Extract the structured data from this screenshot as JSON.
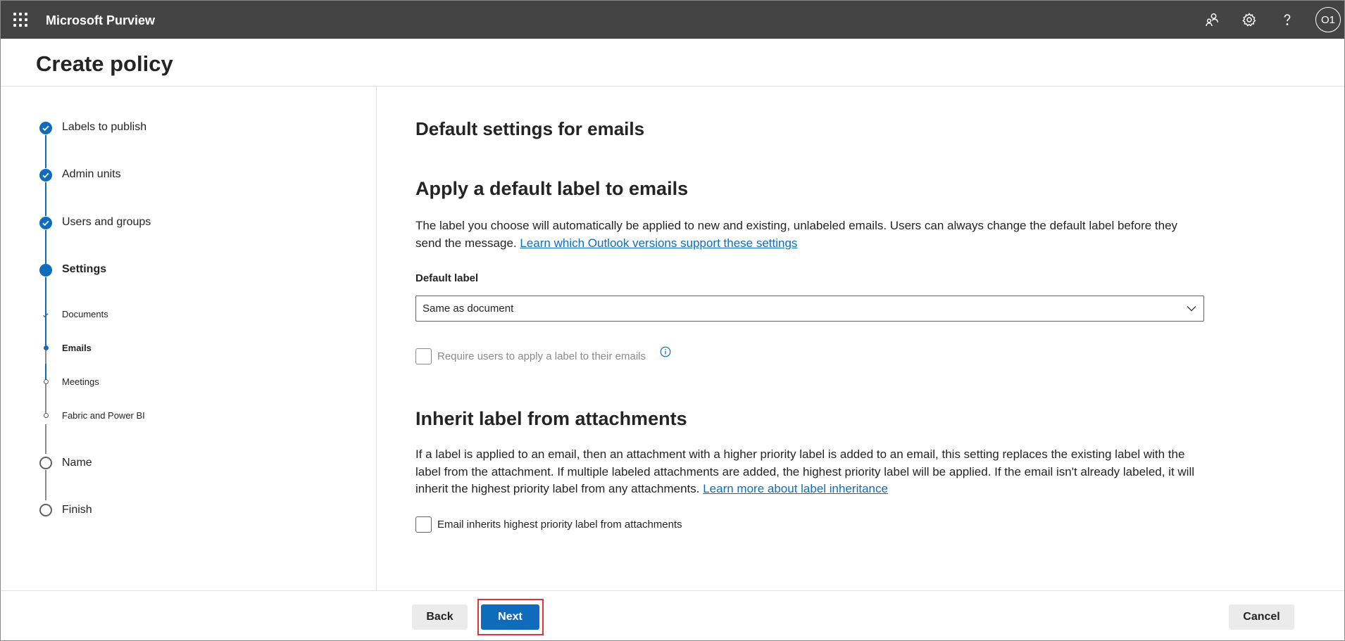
{
  "app": {
    "name": "Microsoft Purview",
    "avatar_initials": "O1"
  },
  "header_icons": [
    "share-people-icon",
    "gear-icon",
    "help-icon"
  ],
  "page": {
    "title": "Create policy"
  },
  "steps": [
    {
      "label": "Labels to publish",
      "state": "done"
    },
    {
      "label": "Admin units",
      "state": "done"
    },
    {
      "label": "Users and groups",
      "state": "done"
    },
    {
      "label": "Settings",
      "state": "current"
    },
    {
      "label": "Documents",
      "state": "sub-done"
    },
    {
      "label": "Emails",
      "state": "sub-current"
    },
    {
      "label": "Meetings",
      "state": "sub-todo"
    },
    {
      "label": "Fabric and Power BI",
      "state": "sub-todo"
    },
    {
      "label": "Name",
      "state": "todo"
    },
    {
      "label": "Finish",
      "state": "todo"
    }
  ],
  "main": {
    "heading": "Default settings for emails",
    "section1": {
      "title": "Apply a default label to emails",
      "description": "The label you choose will automatically be applied to new and existing, unlabeled emails. Users can always change the default label before they send the message.",
      "link": "Learn which Outlook versions support these settings",
      "field_label": "Default label",
      "dropdown_value": "Same as document",
      "checkbox_label": "Require users to apply a label to their emails",
      "checkbox_checked": false,
      "checkbox_disabled": true
    },
    "section2": {
      "title": "Inherit label from attachments",
      "description": "If a label is applied to an email, then an attachment with a higher priority label is added to an email, this setting replaces the existing label with the label from the attachment. If multiple labeled attachments are added, the highest priority label will be applied. If the email isn't already labeled, it will inherit the highest priority label from any attachments.",
      "link": "Learn more about label inheritance",
      "checkbox_label": "Email inherits highest priority label from attachments",
      "checkbox_checked": false
    }
  },
  "footer": {
    "back": "Back",
    "next": "Next",
    "cancel": "Cancel"
  },
  "colors": {
    "topbar": "#444444",
    "accent": "#0f6cbd",
    "highlight_box": "#e0333a"
  }
}
